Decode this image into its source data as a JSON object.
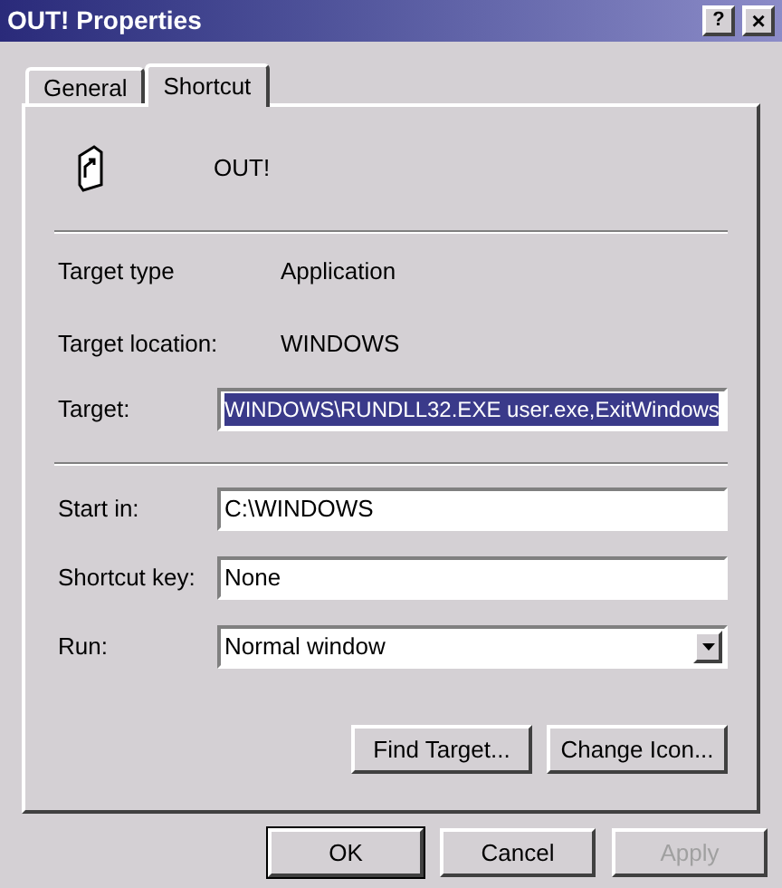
{
  "window": {
    "title": "OUT! Properties",
    "help_button": "?",
    "close_button": "×"
  },
  "tabs": [
    {
      "label": "General",
      "selected": false
    },
    {
      "label": "Shortcut",
      "selected": true
    }
  ],
  "header": {
    "name": "OUT!"
  },
  "info": [
    {
      "label": "Target type",
      "value": "Application"
    },
    {
      "label": "Target location:",
      "value": "WINDOWS"
    }
  ],
  "target": {
    "label": "Target:",
    "value": "WINDOWS\\RUNDLL32.EXE user.exe,ExitWindows",
    "selected": true
  },
  "fields": [
    {
      "kind": "text",
      "label": "Start in:",
      "value": "C:\\WINDOWS"
    },
    {
      "kind": "text",
      "label": "Shortcut key:",
      "value": "None"
    },
    {
      "kind": "dropdown",
      "label": "Run:",
      "value": "Normal window"
    }
  ],
  "panel_buttons": [
    {
      "label": "Find Target...",
      "disabled": false
    },
    {
      "label": "Change Icon...",
      "disabled": false
    }
  ],
  "buttons": [
    {
      "label": "OK",
      "default": true,
      "disabled": false
    },
    {
      "label": "Cancel",
      "default": false,
      "disabled": false
    },
    {
      "label": "Apply",
      "default": false,
      "disabled": true
    }
  ]
}
